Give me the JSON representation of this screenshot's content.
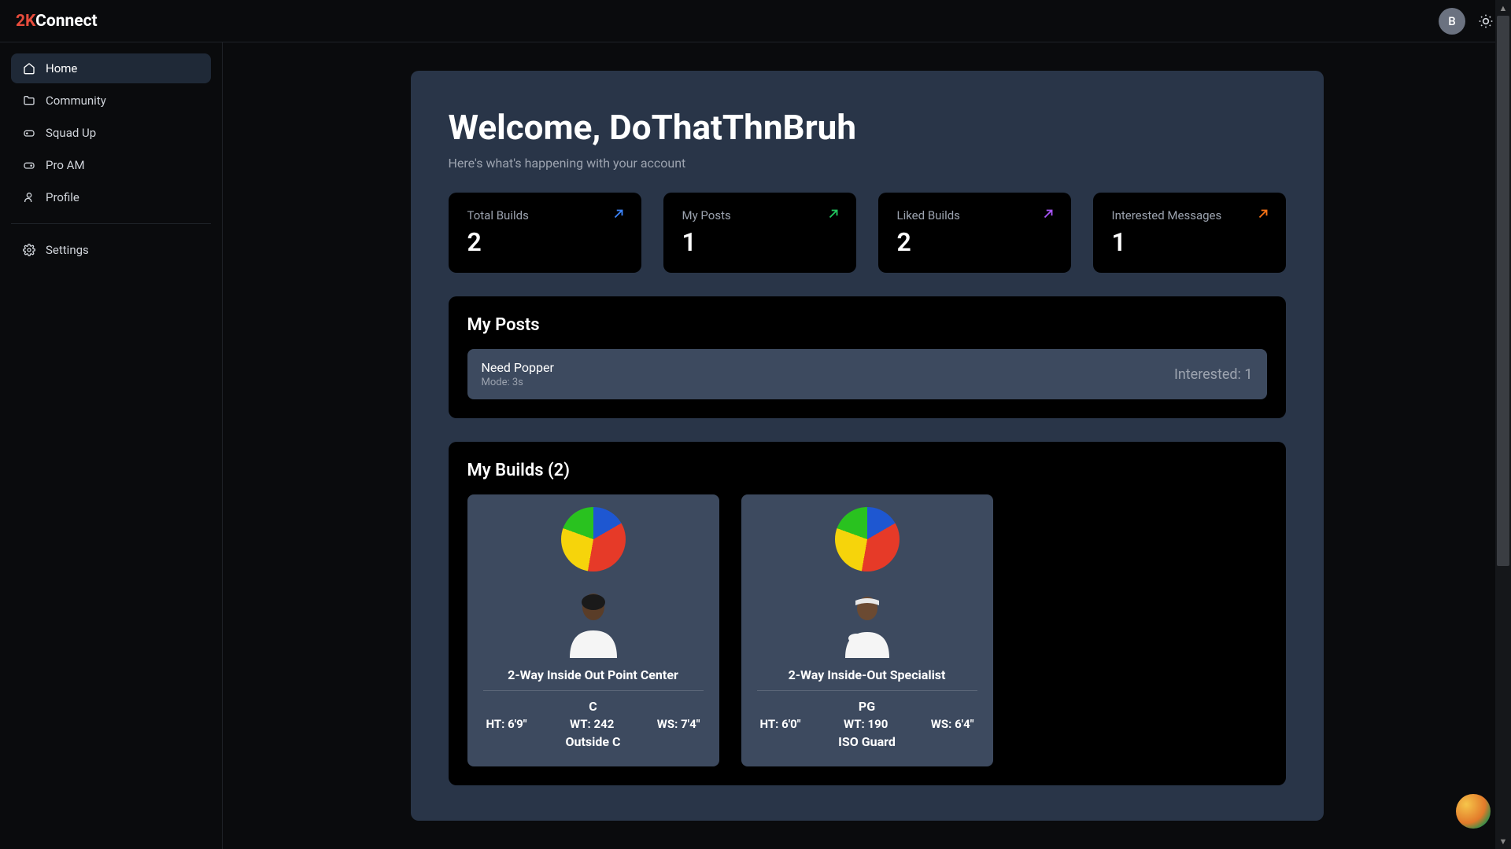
{
  "brand": {
    "prefix": "2K",
    "suffix": "Connect"
  },
  "topbar": {
    "avatar_initial": "B"
  },
  "sidebar": {
    "items": [
      {
        "label": "Home",
        "icon": "home",
        "active": true
      },
      {
        "label": "Community",
        "icon": "folder",
        "active": false
      },
      {
        "label": "Squad Up",
        "icon": "controller",
        "active": false
      },
      {
        "label": "Pro AM",
        "icon": "controller",
        "active": false
      },
      {
        "label": "Profile",
        "icon": "user",
        "active": false
      }
    ],
    "settings_label": "Settings"
  },
  "welcome": {
    "title": "Welcome, DoThatThnBruh",
    "subtitle": "Here's what's happening with your account"
  },
  "stats": [
    {
      "label": "Total Builds",
      "value": "2",
      "arrow_color": "#3b82f6"
    },
    {
      "label": "My Posts",
      "value": "1",
      "arrow_color": "#22c55e"
    },
    {
      "label": "Liked Builds",
      "value": "2",
      "arrow_color": "#a855f7"
    },
    {
      "label": "Interested Messages",
      "value": "1",
      "arrow_color": "#f97316"
    }
  ],
  "posts_section": {
    "title": "My Posts",
    "posts": [
      {
        "title": "Need Popper",
        "mode": "Mode: 3s",
        "interested": "Interested: 1"
      }
    ]
  },
  "builds_section": {
    "title": "My Builds (2)",
    "builds": [
      {
        "name": "2-Way Inside Out Point Center",
        "pos": "C",
        "ht": "HT: 6'9\"",
        "wt": "WT: 242",
        "ws": "WS: 7'4\"",
        "role": "Outside C"
      },
      {
        "name": "2-Way Inside-Out Specialist",
        "pos": "PG",
        "ht": "HT: 6'0\"",
        "wt": "WT: 190",
        "ws": "WS: 6'4\"",
        "role": "ISO Guard"
      }
    ]
  },
  "chart_data": [
    {
      "type": "pie",
      "title": "Build 1 attribute distribution",
      "series": [
        {
          "name": "blue",
          "value": 17
        },
        {
          "name": "red",
          "value": 36
        },
        {
          "name": "yellow",
          "value": 28
        },
        {
          "name": "green",
          "value": 19
        }
      ]
    },
    {
      "type": "pie",
      "title": "Build 2 attribute distribution",
      "series": [
        {
          "name": "blue",
          "value": 17
        },
        {
          "name": "red",
          "value": 36
        },
        {
          "name": "yellow",
          "value": 28
        },
        {
          "name": "green",
          "value": 19
        }
      ]
    }
  ]
}
